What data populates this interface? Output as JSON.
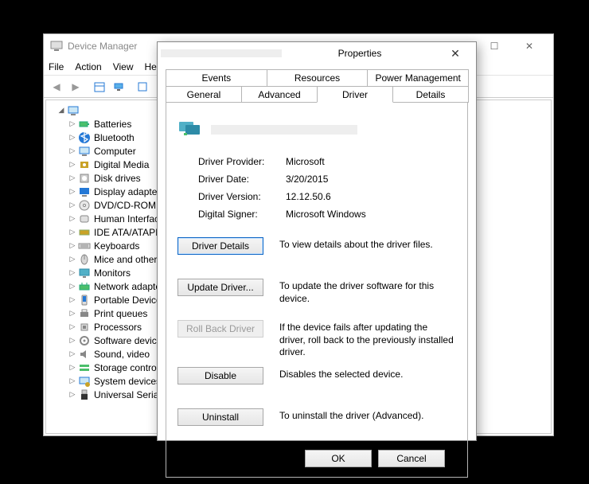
{
  "parent_window": {
    "title": "Device Manager",
    "menus": [
      "File",
      "Action",
      "View",
      "Help"
    ],
    "winbtns": {
      "min": "—",
      "max": "☐",
      "close": "✕"
    }
  },
  "tree": {
    "root": "",
    "nodes": [
      {
        "label": "Batteries",
        "icon": "battery"
      },
      {
        "label": "Bluetooth",
        "icon": "bluetooth"
      },
      {
        "label": "Computer",
        "icon": "computer"
      },
      {
        "label": "Digital Media",
        "icon": "media"
      },
      {
        "label": "Disk drives",
        "icon": "disk"
      },
      {
        "label": "Display adapters",
        "icon": "display"
      },
      {
        "label": "DVD/CD-ROM",
        "icon": "dvd"
      },
      {
        "label": "Human Interface",
        "icon": "hid"
      },
      {
        "label": "IDE ATA/ATAPI",
        "icon": "ide"
      },
      {
        "label": "Keyboards",
        "icon": "keyboard"
      },
      {
        "label": "Mice and other",
        "icon": "mouse"
      },
      {
        "label": "Monitors",
        "icon": "monitor"
      },
      {
        "label": "Network adapters",
        "icon": "network"
      },
      {
        "label": "Portable Devices",
        "icon": "portable"
      },
      {
        "label": "Print queues",
        "icon": "printer"
      },
      {
        "label": "Processors",
        "icon": "cpu"
      },
      {
        "label": "Software devices",
        "icon": "software"
      },
      {
        "label": "Sound, video",
        "icon": "sound"
      },
      {
        "label": "Storage controllers",
        "icon": "storage"
      },
      {
        "label": "System devices",
        "icon": "system"
      },
      {
        "label": "Universal Serial",
        "icon": "usb"
      }
    ]
  },
  "dialog": {
    "title": "Properties",
    "tabs_top": [
      "Events",
      "Resources",
      "Power Management"
    ],
    "tabs_bottom": [
      "General",
      "Advanced",
      "Driver",
      "Details"
    ],
    "active_tab": "Driver",
    "info": {
      "provider_label": "Driver Provider:",
      "provider_value": "Microsoft",
      "date_label": "Driver Date:",
      "date_value": "3/20/2015",
      "version_label": "Driver Version:",
      "version_value": "12.12.50.6",
      "signer_label": "Digital Signer:",
      "signer_value": "Microsoft Windows"
    },
    "buttons": {
      "details": {
        "label": "Driver Details",
        "desc": "To view details about the driver files."
      },
      "update": {
        "label": "Update Driver...",
        "desc": "To update the driver software for this device."
      },
      "rollback": {
        "label": "Roll Back Driver",
        "desc": "If the device fails after updating the driver, roll back to the previously installed driver."
      },
      "disable": {
        "label": "Disable",
        "desc": "Disables the selected device."
      },
      "uninstall": {
        "label": "Uninstall",
        "desc": "To uninstall the driver (Advanced)."
      }
    },
    "footer": {
      "ok": "OK",
      "cancel": "Cancel"
    },
    "close_glyph": "✕"
  },
  "icons": {
    "pc": "#51b0c7",
    "green": "#4bbf6b",
    "blue": "#2478d6",
    "grey": "#888",
    "gold": "#c9a227"
  }
}
